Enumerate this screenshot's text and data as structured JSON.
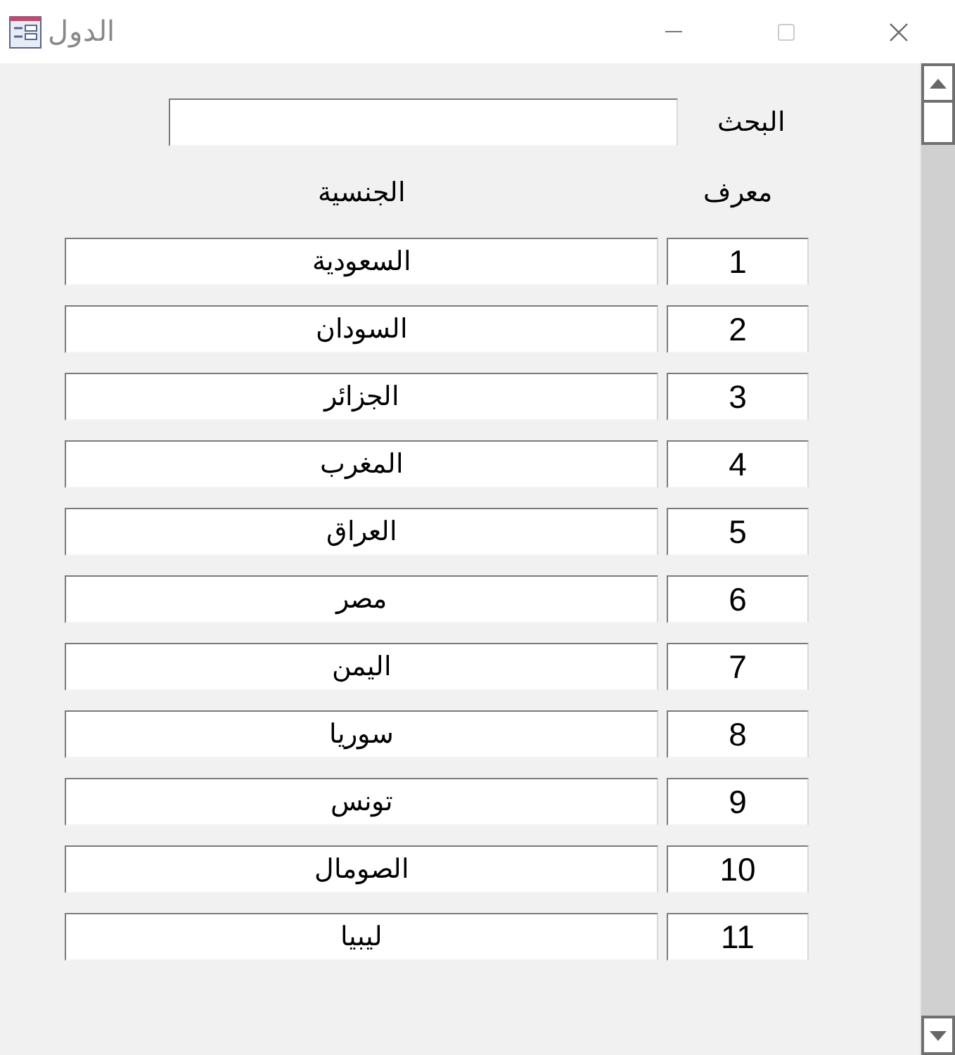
{
  "window": {
    "title": "الدول"
  },
  "search": {
    "label": "البحث"
  },
  "table": {
    "columns": [
      "معرف",
      "الجنسية"
    ],
    "rows": [
      {
        "id": "1",
        "nationality": "السعودية"
      },
      {
        "id": "2",
        "nationality": "السودان"
      },
      {
        "id": "3",
        "nationality": "الجزائر"
      },
      {
        "id": "4",
        "nationality": "المغرب"
      },
      {
        "id": "5",
        "nationality": "العراق"
      },
      {
        "id": "6",
        "nationality": "مصر"
      },
      {
        "id": "7",
        "nationality": "اليمن"
      },
      {
        "id": "8",
        "nationality": "سوريا"
      },
      {
        "id": "9",
        "nationality": "تونس"
      },
      {
        "id": "10",
        "nationality": "الصومال"
      },
      {
        "id": "11",
        "nationality": "ليبيا"
      }
    ]
  }
}
